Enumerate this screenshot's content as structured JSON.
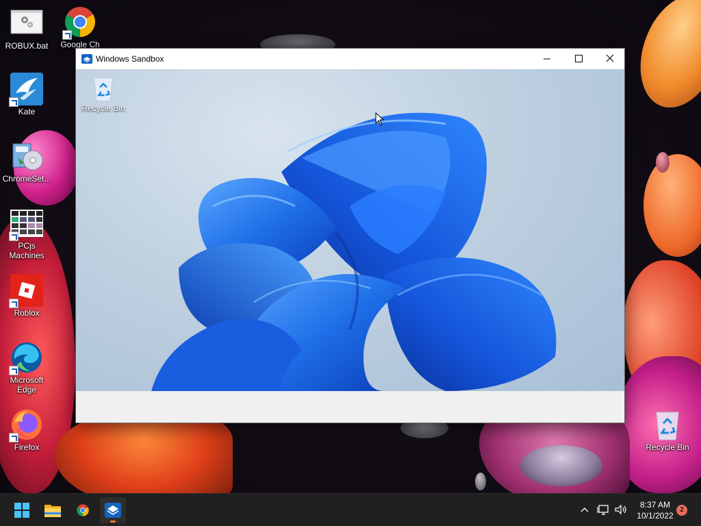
{
  "desktop": {
    "icons": [
      {
        "label": "ROBUX.bat",
        "icon": "batch-file-icon"
      },
      {
        "label": "Google Ch",
        "icon": "chrome-icon"
      },
      {
        "label": "Kate",
        "icon": "kate-icon"
      },
      {
        "label": "ChromeSet...",
        "icon": "installer-icon"
      },
      {
        "label": "PCjs Machines",
        "icon": "pcjs-icon"
      },
      {
        "label": "Roblox",
        "icon": "roblox-icon"
      },
      {
        "label": "Microsoft Edge",
        "icon": "edge-icon"
      },
      {
        "label": "Firefox",
        "icon": "firefox-icon"
      },
      {
        "label": "Recycle Bin",
        "icon": "recycle-bin-icon"
      }
    ]
  },
  "sandbox_window": {
    "title": "Windows Sandbox",
    "guest_desktop": {
      "recycle_bin_label": "Recycle Bin",
      "wallpaper": "windows-11-bloom"
    }
  },
  "taskbar": {
    "apps": [
      {
        "name": "Start",
        "icon": "windows-start-icon"
      },
      {
        "name": "File Explorer",
        "icon": "folder-icon"
      },
      {
        "name": "Google Chrome",
        "icon": "chrome-icon"
      },
      {
        "name": "Windows Sandbox",
        "icon": "sandbox-icon",
        "active": true
      }
    ],
    "tray": {
      "time": "8:37 AM",
      "date": "10/1/2022",
      "notification_count": "2"
    }
  },
  "colors": {
    "taskbar_bg": "#202020",
    "accent": "#0067c0",
    "active_indicator": "#e8803a"
  }
}
